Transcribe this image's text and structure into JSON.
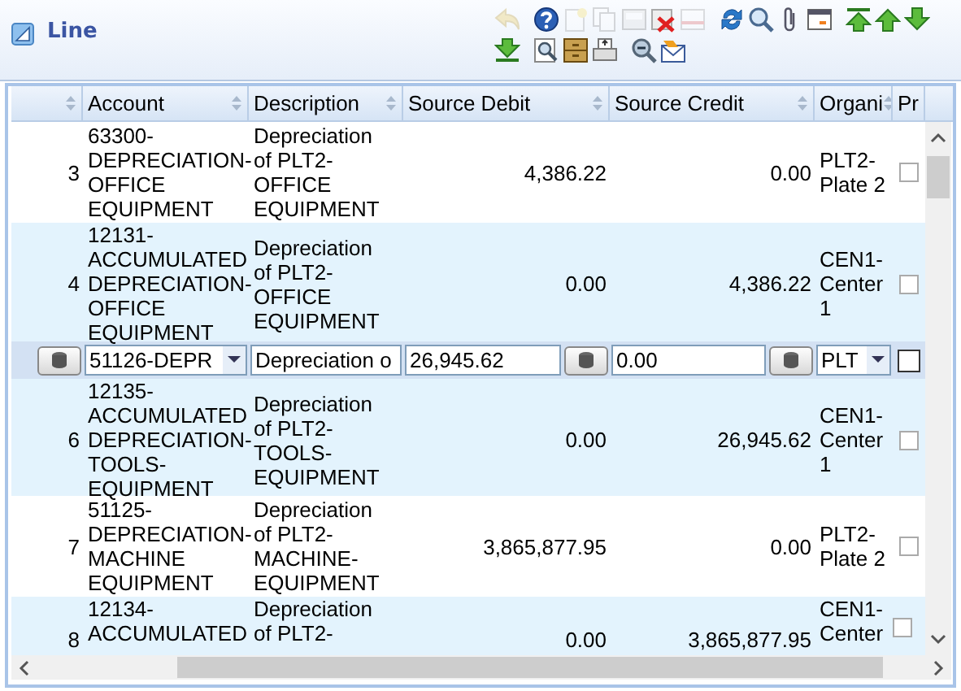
{
  "panel": {
    "title": "Line"
  },
  "toolbar": {
    "rows": [
      [
        [
          {
            "kind": "undo",
            "disabled": true
          }
        ],
        [
          {
            "kind": "help",
            "disabled": false
          },
          {
            "kind": "new",
            "disabled": true
          },
          {
            "kind": "copy",
            "disabled": true
          },
          {
            "kind": "save",
            "disabled": true
          },
          {
            "kind": "delete",
            "disabled": false
          },
          {
            "kind": "form",
            "disabled": true
          }
        ],
        [
          {
            "kind": "refresh",
            "disabled": false
          },
          {
            "kind": "search",
            "disabled": false
          },
          {
            "kind": "attach",
            "disabled": false
          },
          {
            "kind": "window",
            "disabled": false
          }
        ],
        [
          {
            "kind": "first",
            "disabled": false
          },
          {
            "kind": "up",
            "disabled": false
          },
          {
            "kind": "down",
            "disabled": false
          }
        ]
      ],
      [
        [
          {
            "kind": "last",
            "disabled": false
          }
        ],
        [
          {
            "kind": "report",
            "disabled": false
          },
          {
            "kind": "archive",
            "disabled": false
          },
          {
            "kind": "print",
            "disabled": false
          }
        ],
        [
          {
            "kind": "zoom",
            "disabled": false
          },
          {
            "kind": "mail",
            "disabled": false
          }
        ]
      ]
    ]
  },
  "table": {
    "columns": [
      {},
      {
        "label": "Account"
      },
      {
        "label": "Description"
      },
      {
        "label": "Source Debit"
      },
      {
        "label": "Source Credit"
      },
      {
        "label": "Organi"
      },
      {
        "label": "Pr"
      }
    ],
    "rows": [
      {
        "kind": "display",
        "number": "3",
        "account": "63300-DEPRECIATION-OFFICE EQUIPMENT",
        "description": "Depreciation of PLT2-OFFICE EQUIPMENT",
        "source_debit": "4,386.22",
        "source_credit": "0.00",
        "organization": "PLT2-Plate 2",
        "processed": false
      },
      {
        "kind": "display",
        "number": "4",
        "account": "12131-ACCUMULATED DEPRECIATION-OFFICE EQUIPMENT",
        "description": "Depreciation of PLT2-OFFICE EQUIPMENT",
        "source_debit": "0.00",
        "source_credit": "4,386.22",
        "organization": "CEN1-Center 1",
        "processed": false
      },
      {
        "kind": "edit",
        "account": "51126-DEPR",
        "description": "Depreciation o",
        "source_debit": "26,945.62",
        "source_credit": "0.00",
        "organization": "PLT",
        "processed": false
      },
      {
        "kind": "display",
        "number": "6",
        "account": "12135-ACCUMULATED DEPRECIATION-TOOLS-EQUIPMENT",
        "description": "Depreciation of PLT2-TOOLS-EQUIPMENT",
        "source_debit": "0.00",
        "source_credit": "26,945.62",
        "organization": "CEN1-Center 1",
        "processed": false
      },
      {
        "kind": "display",
        "number": "7",
        "account": "51125-DEPRECIATION-MACHINE EQUIPMENT",
        "description": "Depreciation of PLT2-MACHINE-EQUIPMENT",
        "source_debit": "3,865,877.95",
        "source_credit": "0.00",
        "organization": "PLT2-Plate 2",
        "processed": false
      },
      {
        "kind": "partial",
        "number": "8",
        "account": "12134-ACCUMULATED",
        "description": "Depreciation of PLT2-",
        "source_debit": "0.00",
        "source_credit": "3,865,877.95",
        "organization": "CEN1-Center",
        "processed": false
      }
    ]
  }
}
